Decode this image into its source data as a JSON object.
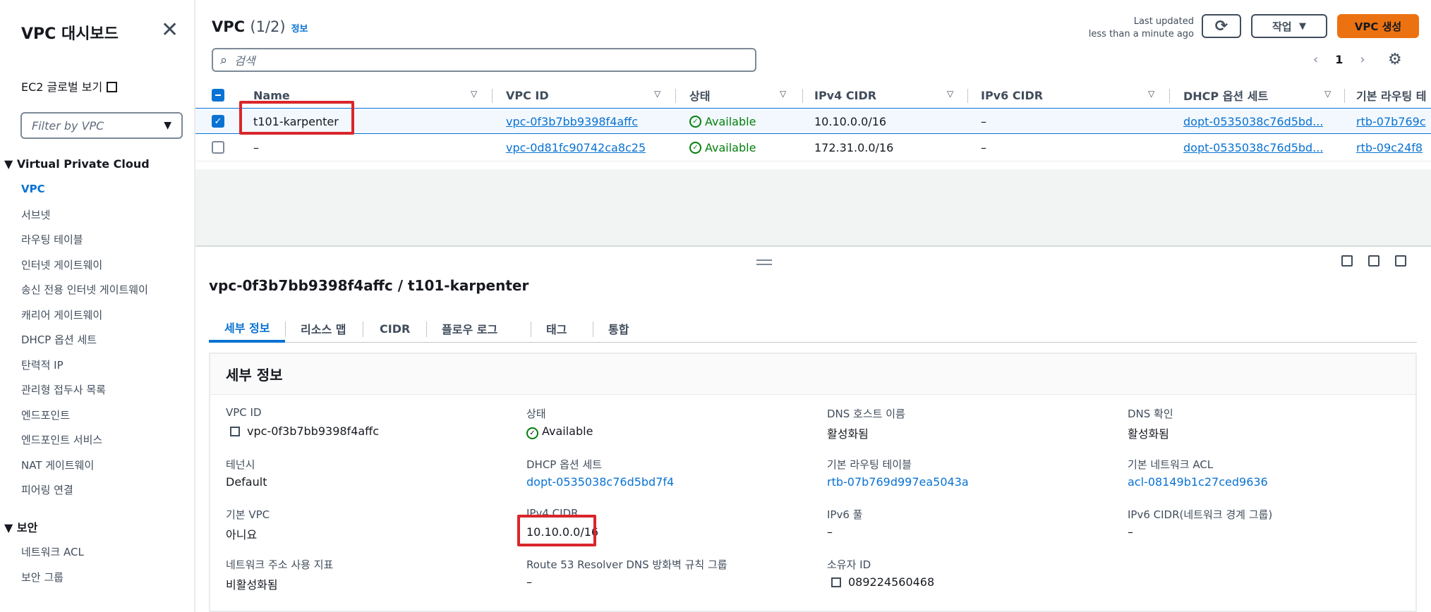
{
  "sidebar": {
    "title": "VPC 대시보드",
    "ec2_link": "EC2 글로벌 보기",
    "filter_placeholder": "Filter by VPC",
    "section_vpc": "Virtual Private Cloud",
    "items": [
      "VPC",
      "서브넷",
      "라우팅 테이블",
      "인터넷 게이트웨이",
      "송신 전용 인터넷 게이트웨이",
      "캐리어 게이트웨이",
      "DHCP 옵션 세트",
      "탄력적 IP",
      "관리형 접두사 목록",
      "엔드포인트",
      "엔드포인트 서비스",
      "NAT 게이트웨이",
      "피어링 연결"
    ],
    "section_security": "보안",
    "security_items": [
      "네트워크 ACL",
      "보안 그룹"
    ]
  },
  "header": {
    "title": "VPC",
    "count": "(1/2)",
    "info": "정보",
    "last_updated_1": "Last updated",
    "last_updated_2": "less than a minute ago",
    "actions_label": "작업",
    "create_label": "VPC 생성",
    "search_placeholder": "검색",
    "page": "1"
  },
  "table": {
    "columns": [
      "Name",
      "VPC ID",
      "상태",
      "IPv4 CIDR",
      "IPv6 CIDR",
      "DHCP 옵션 세트",
      "기본 라우팅 테"
    ],
    "rows": [
      {
        "name": "t101-karpenter",
        "vpc_id": "vpc-0f3b7bb9398f4affc",
        "status": "Available",
        "ipv4": "10.10.0.0/16",
        "ipv6": "–",
        "dhcp": "dopt-0535038c76d5bd...",
        "rtb": "rtb-07b769c"
      },
      {
        "name": "–",
        "vpc_id": "vpc-0d81fc90742ca8c25",
        "status": "Available",
        "ipv4": "172.31.0.0/16",
        "ipv6": "–",
        "dhcp": "dopt-0535038c76d5bd...",
        "rtb": "rtb-09c24f8"
      }
    ]
  },
  "detail": {
    "title": "vpc-0f3b7bb9398f4affc / t101-karpenter",
    "tabs": [
      "세부 정보",
      "리소스 맵",
      "CIDR",
      "플로우 로그",
      "태그",
      "통합"
    ],
    "panel_title": "세부 정보",
    "fields": {
      "vpc_id_label": "VPC ID",
      "vpc_id": "vpc-0f3b7bb9398f4affc",
      "status_label": "상태",
      "status": "Available",
      "dns_host_label": "DNS 호스트 이름",
      "dns_host": "활성화됨",
      "dns_res_label": "DNS 확인",
      "dns_res": "활성화됨",
      "tenancy_label": "테넌시",
      "tenancy": "Default",
      "dhcp_label": "DHCP 옵션 세트",
      "dhcp": "dopt-0535038c76d5bd7f4",
      "rtb_label": "기본 라우팅 테이블",
      "rtb": "rtb-07b769d997ea5043a",
      "acl_label": "기본 네트워크 ACL",
      "acl": "acl-08149b1c27ced9636",
      "default_vpc_label": "기본 VPC",
      "default_vpc": "아니요",
      "ipv4_label": "IPv4 CIDR",
      "ipv4": "10.10.0.0/16",
      "ipv6pool_label": "IPv6 풀",
      "ipv6pool": "–",
      "ipv6cidr_label": "IPv6 CIDR(네트워크 경계 그룹)",
      "ipv6cidr": "–",
      "netaddr_label": "네트워크 주소 사용 지표",
      "netaddr": "비활성화됨",
      "r53_label": "Route 53 Resolver DNS 방화벽 규칙 그룹",
      "r53": "–",
      "owner_label": "소유자 ID",
      "owner": "089224560468"
    }
  },
  "colors": {
    "accent": "#0972d3",
    "primary_button": "#ec7211",
    "success": "#037f0c",
    "highlight": "#d9262b"
  }
}
